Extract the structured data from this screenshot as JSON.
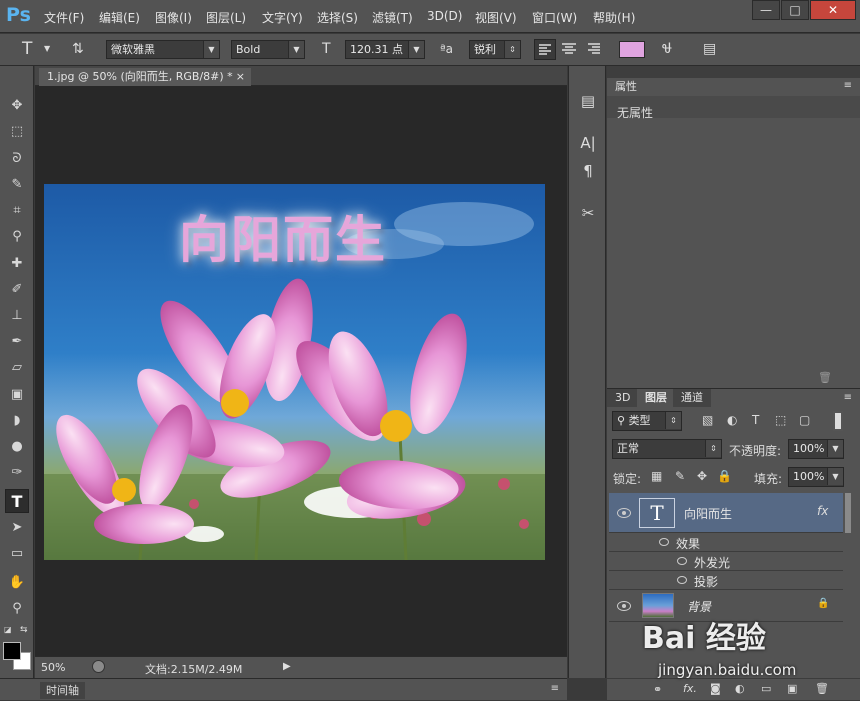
{
  "menubar": {
    "logo": "Ps",
    "items": [
      "文件(F)",
      "编辑(E)",
      "图像(I)",
      "图层(L)",
      "文字(Y)",
      "选择(S)",
      "滤镜(T)",
      "3D(D)",
      "视图(V)",
      "窗口(W)",
      "帮助(H)"
    ],
    "win_buttons": [
      "—",
      "□",
      "✕"
    ]
  },
  "options": {
    "tool_glyph": "T",
    "font_family": "微软雅黑",
    "font_style": "Bold",
    "font_size": "120.31 点",
    "aa_label": "ªa",
    "anti_alias": "锐利"
  },
  "document": {
    "tab_title": "1.jpg @ 50% (向阳而生, RGB/8#) *",
    "tab_close": "×",
    "canvas_text": "向阳而生"
  },
  "status": {
    "zoom": "50%",
    "doc_info": "文档:2.15M/2.49M",
    "arrow": "▶"
  },
  "timeline": {
    "label": "时间轴"
  },
  "properties": {
    "tab": "属性",
    "content": "无属性"
  },
  "layers_panel": {
    "tabs": [
      "3D",
      "图层",
      "通道"
    ],
    "filter_type": "类型",
    "blend_mode": "正常",
    "opacity_label": "不透明度:",
    "opacity_value": "100%",
    "lock_label": "锁定:",
    "fill_label": "填充:",
    "fill_value": "100%",
    "text_layer_name": "向阳而生",
    "fx_label": "fx",
    "effects_label": "效果",
    "effect_1": "外发光",
    "effect_2": "投影",
    "bg_layer_name": "背景"
  },
  "watermark": {
    "brand": "Bai 经验",
    "url": "jingyan.baidu.com"
  },
  "colors": {
    "ui_panel": "#535353",
    "ui_dark": "#282828",
    "text_pink": "#e6a6da",
    "layer_selected": "#566985",
    "ps_blue": "#5ab4f0"
  }
}
